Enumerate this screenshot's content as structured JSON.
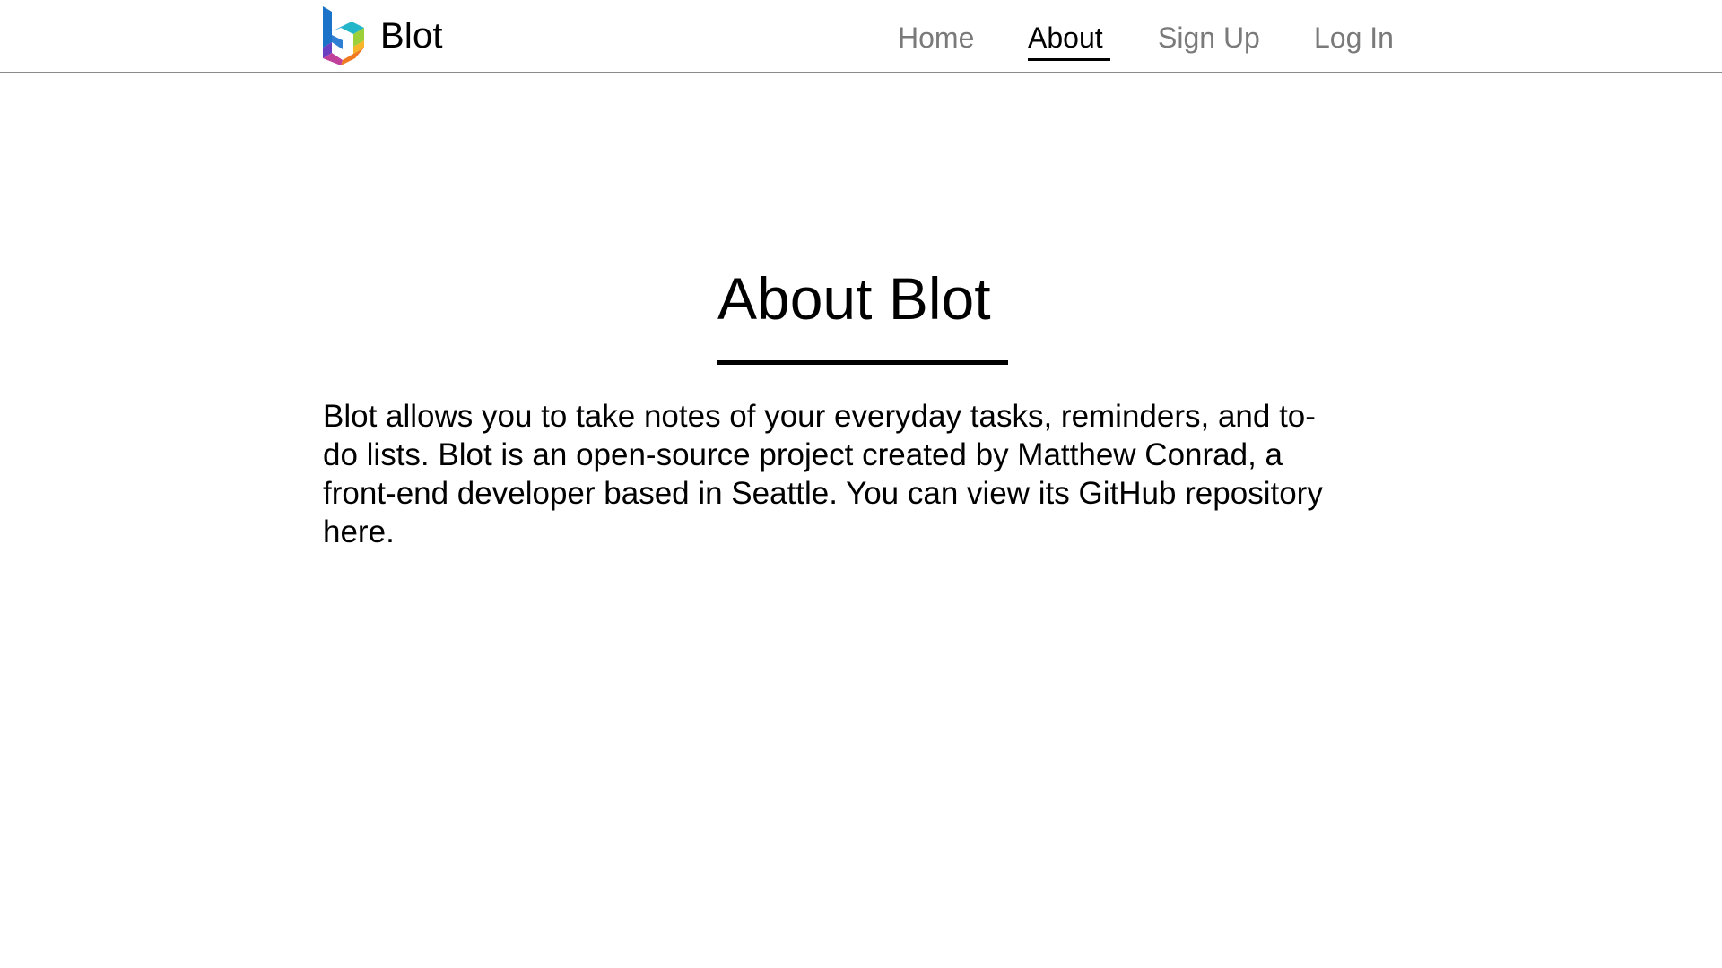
{
  "app": {
    "brand_name": "Blot"
  },
  "nav": {
    "items": [
      {
        "label": "Home",
        "active": false
      },
      {
        "label": "About",
        "active": true
      },
      {
        "label": "Sign Up",
        "active": false
      },
      {
        "label": "Log In",
        "active": false
      }
    ]
  },
  "main": {
    "title": "About Blot",
    "paragraph_before_link": "Blot allows you to take notes of your everyday tasks, reminders, and to-do lists. Blot is an open-source project created by Matthew Conrad, a front-end developer based in Seattle. You can view its GitHub repository ",
    "link_text": "here",
    "paragraph_after_link": "."
  },
  "colors": {
    "nav_inactive": "#7a7a7a",
    "nav_active": "#000000",
    "header_border": "#8a8a8a",
    "background": "#ffffff"
  },
  "icons": {
    "logo": "blot-logo-icon"
  }
}
